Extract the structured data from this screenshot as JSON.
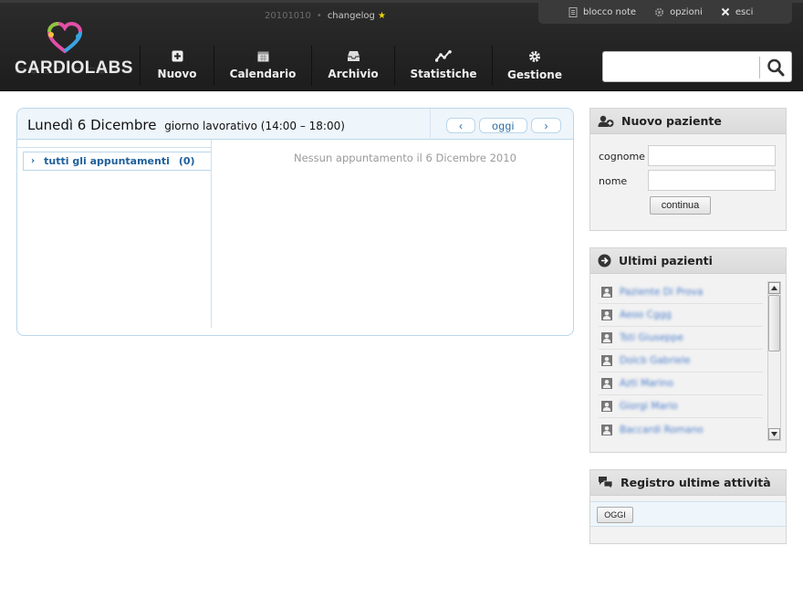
{
  "header": {
    "version": "20101010",
    "changelog": "changelog",
    "star": "★",
    "top_links": {
      "notes": "blocco note",
      "options": "opzioni",
      "logout": "esci"
    },
    "brand": "CARDIOLABS",
    "nav": [
      {
        "label": "Nuovo",
        "icon": "plus-square-icon"
      },
      {
        "label": "Calendario",
        "icon": "calendar-icon"
      },
      {
        "label": "Archivio",
        "icon": "inbox-archive-icon"
      },
      {
        "label": "Statistiche",
        "icon": "line-chart-icon"
      },
      {
        "label": "Gestione",
        "icon": "gear-icon"
      }
    ],
    "search": {
      "value": "",
      "placeholder": ""
    }
  },
  "calendar": {
    "date": "Lunedì 6 Dicembre",
    "work_hours": "giorno lavorativo (14:00 – 18:00)",
    "prev": "‹",
    "today": "oggi",
    "next": "›",
    "all_appointments": "tutti gli appuntamenti",
    "all_count": "(0)",
    "empty_message": "Nessun appuntamento il 6 Dicembre 2010"
  },
  "new_patient": {
    "title": "Nuovo paziente",
    "surname_label": "cognome",
    "name_label": "nome",
    "continue": "continua"
  },
  "recent_patients": {
    "title": "Ultimi pazienti",
    "items": [
      "Paziente Di Prova",
      "Aeoo Cggg",
      "Tsti Giuseppe",
      "Dolcb Gabriele",
      "Azti Marino",
      "Giorgi Mario",
      "Baccardi Romano"
    ]
  },
  "activity_log": {
    "title": "Registro ultime attività",
    "today_button": "OGGI"
  }
}
